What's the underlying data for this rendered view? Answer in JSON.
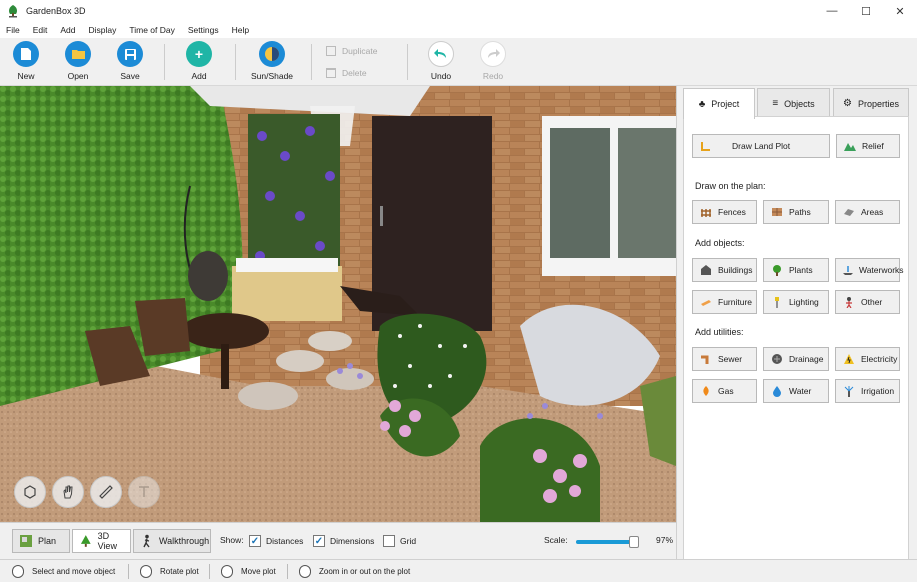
{
  "window": {
    "title": "GardenBox 3D",
    "minimize": "—",
    "maximize": "☐",
    "close": "✕"
  },
  "menu": [
    "File",
    "Edit",
    "Add",
    "Display",
    "Time of Day",
    "Settings",
    "Help"
  ],
  "toolbar": {
    "new": "New",
    "open": "Open",
    "save": "Save",
    "add": "Add",
    "sunshade": "Sun/Shade",
    "duplicate": "Duplicate",
    "delete": "Delete",
    "undo": "Undo",
    "redo": "Redo"
  },
  "tabs": {
    "project": "Project",
    "objects": "Objects",
    "properties": "Properties"
  },
  "project": {
    "draw_land_plot": "Draw Land Plot",
    "relief": "Relief",
    "draw_on_plan": "Draw on the plan:",
    "fences": "Fences",
    "paths": "Paths",
    "areas": "Areas",
    "add_objects": "Add objects:",
    "buildings": "Buildings",
    "plants": "Plants",
    "waterworks": "Waterworks",
    "furniture": "Furniture",
    "lighting": "Lighting",
    "other": "Other",
    "add_utilities": "Add utilities:",
    "sewer": "Sewer",
    "drainage": "Drainage",
    "electricity": "Electricity",
    "gas": "Gas",
    "water": "Water",
    "irrigation": "Irrigation"
  },
  "views": {
    "plan": "Plan",
    "view3d": "3D View",
    "walkthrough": "Walkthrough"
  },
  "show": {
    "label": "Show:",
    "distances": {
      "label": "Distances",
      "checked": true
    },
    "dimensions": {
      "label": "Dimensions",
      "checked": true
    },
    "grid": {
      "label": "Grid",
      "checked": false
    }
  },
  "scale": {
    "label": "Scale:",
    "value": "97%",
    "fraction": 0.97
  },
  "status": {
    "select": "Select and move object",
    "rotate": "Rotate plot",
    "move": "Move plot",
    "zoom": "Zoom in or out on the plot"
  },
  "colors": {
    "accent": "#1a73b5",
    "toolbar_blue": "#1c8bd6",
    "add_teal": "#1fb5a6"
  }
}
